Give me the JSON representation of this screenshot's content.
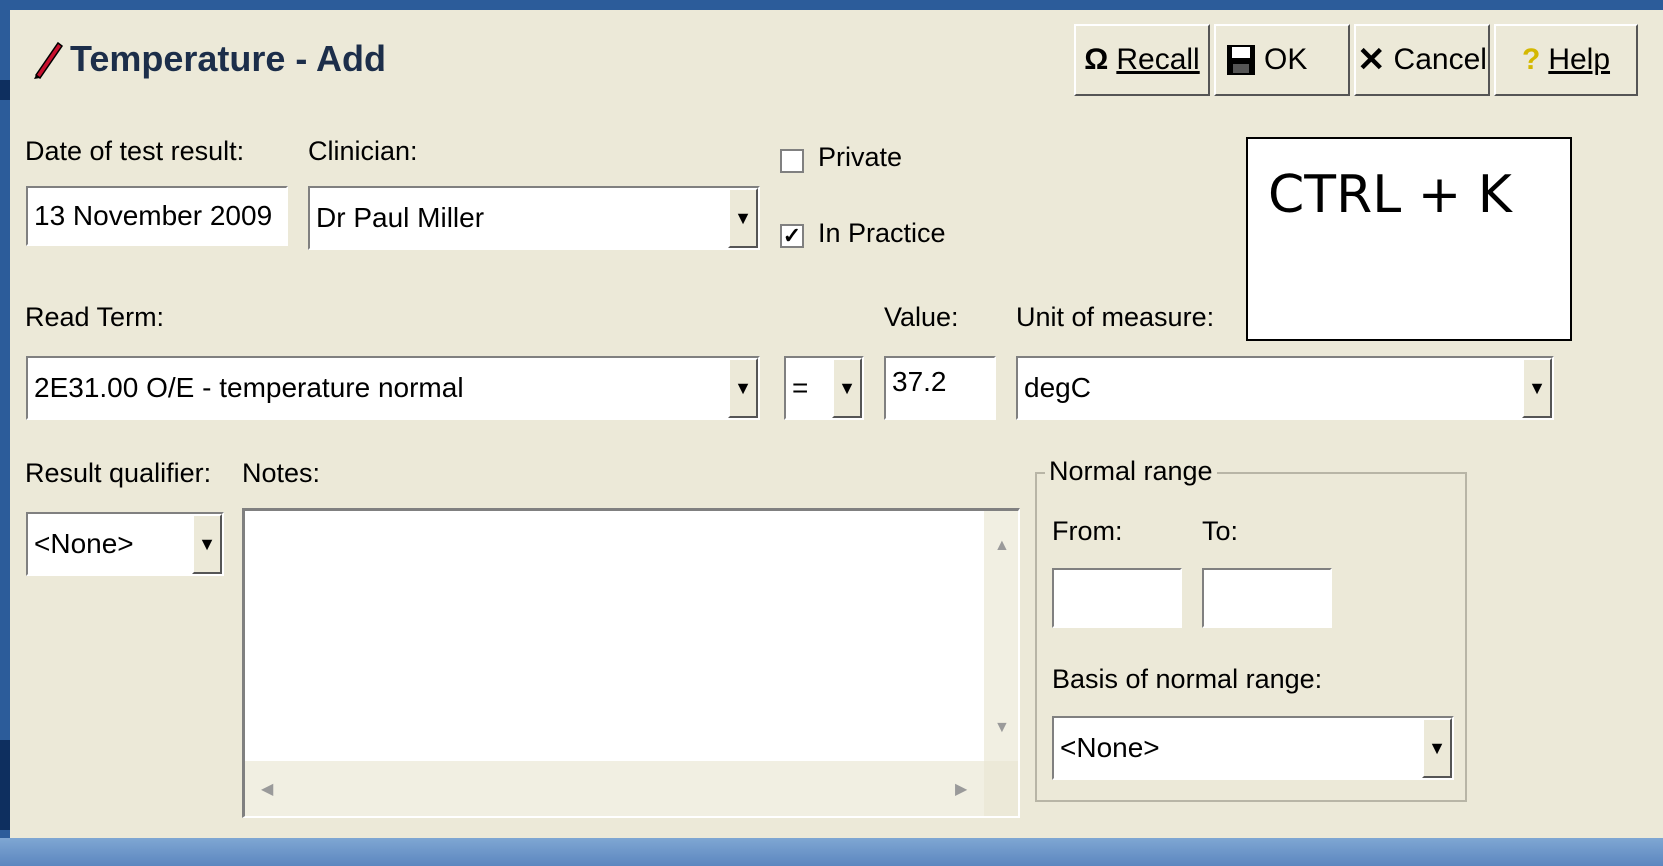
{
  "dialog": {
    "title": "Temperature - Add",
    "title_icon": "pencil-icon"
  },
  "toolbar": {
    "recall_label": "Recall",
    "recall_icon": "omega-icon",
    "ok_label": "OK",
    "ok_icon": "save-disk-icon",
    "cancel_label": "Cancel",
    "cancel_icon": "x-icon",
    "help_label": "Help",
    "help_icon": "question-icon"
  },
  "form": {
    "date_label": "Date of test result:",
    "date_value": "13 November 2009",
    "clinician_label": "Clinician:",
    "clinician_value": "Dr Paul Miller",
    "private_label": "Private",
    "private_checked": false,
    "in_practice_label": "In Practice",
    "in_practice_checked": true,
    "read_term_label": "Read Term:",
    "read_term_value": "2E31.00 O/E - temperature normal",
    "operator_value": "=",
    "value_label": "Value:",
    "value_value": "37.2",
    "unit_label": "Unit of measure:",
    "unit_value": "degC",
    "qualifier_label": "Result qualifier:",
    "qualifier_value": "<None>",
    "notes_label": "Notes:",
    "notes_value": ""
  },
  "normal_range": {
    "legend": "Normal range",
    "from_label": "From:",
    "from_value": "",
    "to_label": "To:",
    "to_value": "",
    "basis_label": "Basis of normal range:",
    "basis_value": "<None>"
  },
  "overlay": {
    "shortcut_text": "CTRL + K"
  },
  "colors": {
    "dialog_bg": "#ECE9D8",
    "frame_blue": "#2C5C9A",
    "title_text": "#1C2E4A"
  }
}
